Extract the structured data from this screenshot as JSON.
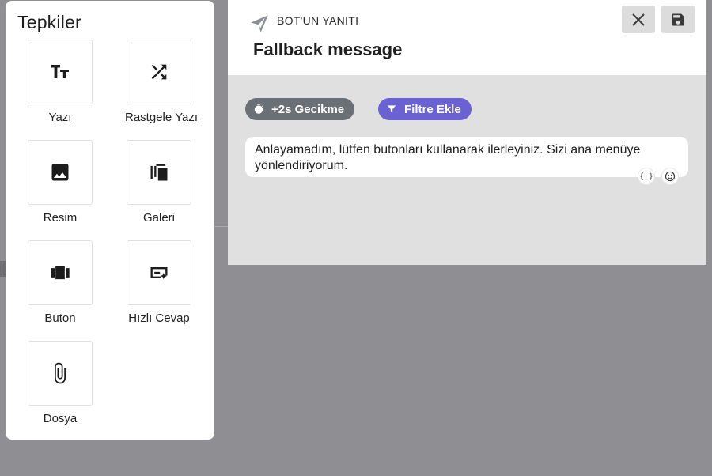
{
  "reactions": {
    "title": "Tepkiler",
    "items": [
      {
        "label": "Yazı",
        "icon": "text-icon"
      },
      {
        "label": "Rastgele Yazı",
        "icon": "shuffle-icon"
      },
      {
        "label": "Resim",
        "icon": "image-icon"
      },
      {
        "label": "Galeri",
        "icon": "gallery-icon"
      },
      {
        "label": "Buton",
        "icon": "carousel-button-icon"
      },
      {
        "label": "Hızlı Cevap",
        "icon": "quick-reply-icon"
      },
      {
        "label": "Dosya",
        "icon": "paperclip-icon"
      }
    ]
  },
  "bot": {
    "label": "BOT'UN YANITI",
    "title": "Fallback message",
    "delay_chip": "+2s Gecikme",
    "filter_chip": "Filtre Ekle",
    "message": "Anlayamadım, lütfen butonları kullanarak ilerleyiniz. Sizi ana menüye yönlendiriyorum.",
    "variable_symbol": "{ }"
  },
  "colors": {
    "backdrop": "#8f8f93",
    "delay_chip": "#6b6f76",
    "filter_chip": "#6a62d2",
    "panel_bg": "#e0e0e0"
  }
}
